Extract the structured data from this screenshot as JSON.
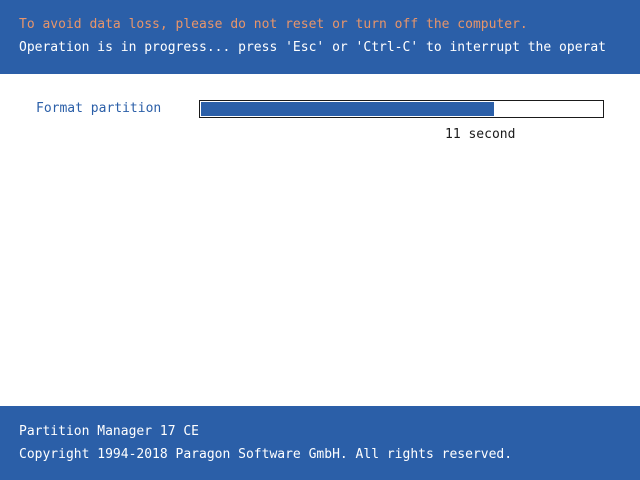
{
  "header": {
    "warning": "To avoid data loss, please do not reset or turn off the computer.",
    "info": "Operation is in progress... press 'Esc' or 'Ctrl-C' to interrupt the operat"
  },
  "operation": {
    "label": "Format partition",
    "progress_fraction": 0.73,
    "time_remaining": "11 second"
  },
  "footer": {
    "product": "Partition Manager 17 CE",
    "copyright": "Copyright 1994-2018 Paragon Software GmbH. All rights reserved."
  },
  "colors": {
    "brand_blue": "#2b5fa8",
    "warning_orange": "#e8956a",
    "background": "#ffffff"
  }
}
